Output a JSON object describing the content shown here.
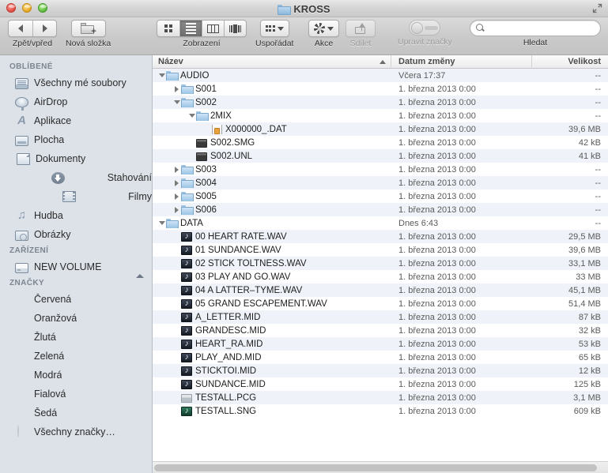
{
  "window": {
    "title": "KROSS",
    "folder_icon": "folder-icon",
    "fullscreen_icon": "fullscreen-icon",
    "traffic_lights": [
      "close-button",
      "minimize-button",
      "zoom-button"
    ]
  },
  "toolbar": {
    "back_forward_label": "Zpět/vpřed",
    "back_icon": "back-arrow-icon",
    "forward_icon": "forward-arrow-icon",
    "new_folder_label": "Nová složka",
    "new_folder_icon": "new-folder-icon",
    "view_label": "Zobrazení",
    "view_modes": [
      {
        "name": "icon-view",
        "icon": "grid-icon",
        "active": false
      },
      {
        "name": "list-view",
        "icon": "list-icon",
        "active": true
      },
      {
        "name": "column-view",
        "icon": "columns-icon",
        "active": false
      },
      {
        "name": "coverflow-view",
        "icon": "coverflow-icon",
        "active": false
      }
    ],
    "arrange_label": "Uspořádat",
    "arrange_icon": "arrange-grid-icon",
    "action_label": "Akce",
    "action_icon": "gear-icon",
    "share_label": "Sdílet",
    "share_icon": "share-icon",
    "share_disabled": true,
    "tags_label": "Upravit značky",
    "tags_icon": "tag-toggle-icon",
    "tags_disabled": true,
    "search_label": "Hledat",
    "search_icon": "search-icon",
    "search_value": "",
    "search_placeholder": ""
  },
  "sidebar": {
    "sections": [
      {
        "header": "OBLÍBENÉ",
        "items": [
          {
            "label": "Všechny mé soubory",
            "icon": "all-files-icon",
            "icon_class": "ico-allfiles"
          },
          {
            "label": "AirDrop",
            "icon": "airdrop-icon",
            "icon_class": "ico-airdrop"
          },
          {
            "label": "Aplikace",
            "icon": "applications-icon",
            "icon_class": "ico-apps",
            "glyph": "A"
          },
          {
            "label": "Plocha",
            "icon": "desktop-icon",
            "icon_class": "ico-desktop"
          },
          {
            "label": "Dokumenty",
            "icon": "documents-icon",
            "icon_class": "ico-docs"
          },
          {
            "label": "Stahování",
            "icon": "downloads-icon",
            "icon_class": "ico-down"
          },
          {
            "label": "Filmy",
            "icon": "movies-icon",
            "icon_class": "ico-movies"
          },
          {
            "label": "Hudba",
            "icon": "music-icon",
            "icon_class": "ico-music",
            "glyph": "♫"
          },
          {
            "label": "Obrázky",
            "icon": "pictures-icon",
            "icon_class": "ico-pics"
          }
        ]
      },
      {
        "header": "ZAŘÍZENÍ",
        "items": [
          {
            "label": "NEW VOLUME",
            "icon": "drive-icon",
            "icon_class": "ico-drive",
            "eject": true,
            "eject_icon": "eject-icon"
          }
        ]
      },
      {
        "header": "ZNAČKY",
        "items": [
          {
            "label": "Červená",
            "icon": "tag-red-icon",
            "dot": "red",
            "color": "#f05a4f"
          },
          {
            "label": "Oranžová",
            "icon": "tag-orange-icon",
            "dot": "orange",
            "color": "#f5a33a"
          },
          {
            "label": "Žlutá",
            "icon": "tag-yellow-icon",
            "dot": "yellow",
            "color": "#f4dc4a"
          },
          {
            "label": "Zelená",
            "icon": "tag-green-icon",
            "dot": "green",
            "color": "#8dc63f"
          },
          {
            "label": "Modrá",
            "icon": "tag-blue-icon",
            "dot": "blue",
            "color": "#5bbdea"
          },
          {
            "label": "Fialová",
            "icon": "tag-purple-icon",
            "dot": "purple",
            "color": "#e078e9"
          },
          {
            "label": "Šedá",
            "icon": "tag-gray-icon",
            "dot": "gray",
            "color": "#c0c0c0"
          },
          {
            "label": "Všechny značky…",
            "icon": "all-tags-icon",
            "dot": "all",
            "color": "#dfe4ea"
          }
        ]
      }
    ]
  },
  "filelist": {
    "columns": [
      {
        "key": "name",
        "label": "Název",
        "sorted": true,
        "sort_icon": "sort-ascending-icon"
      },
      {
        "key": "date",
        "label": "Datum změny",
        "sorted": false
      },
      {
        "key": "size",
        "label": "Velikost",
        "sorted": false
      }
    ],
    "rows": [
      {
        "name": "AUDIO",
        "date": "Včera 17:37",
        "size": "--",
        "indent": 0,
        "disclosure": "open",
        "icon": "folder-icon",
        "icon_class": "folder"
      },
      {
        "name": "S001",
        "date": "1. března 2013 0:00",
        "size": "--",
        "indent": 1,
        "disclosure": "closed",
        "icon": "folder-icon",
        "icon_class": "folder"
      },
      {
        "name": "S002",
        "date": "1. března 2013 0:00",
        "size": "--",
        "indent": 1,
        "disclosure": "open",
        "icon": "folder-icon",
        "icon_class": "folder"
      },
      {
        "name": "2MIX",
        "date": "1. března 2013 0:00",
        "size": "--",
        "indent": 2,
        "disclosure": "open",
        "icon": "folder-icon",
        "icon_class": "folder"
      },
      {
        "name": "X000000_.DAT",
        "date": "1. března 2013 0:00",
        "size": "39,6 MB",
        "indent": 3,
        "disclosure": "none",
        "icon": "locked-document-icon",
        "icon_class": "dat"
      },
      {
        "name": "S002.SMG",
        "date": "1. března 2013 0:00",
        "size": "42 kB",
        "indent": 2,
        "disclosure": "none",
        "icon": "unix-executable-icon",
        "icon_class": "unix"
      },
      {
        "name": "S002.UNL",
        "date": "1. března 2013 0:00",
        "size": "41 kB",
        "indent": 2,
        "disclosure": "none",
        "icon": "unix-executable-icon",
        "icon_class": "unix"
      },
      {
        "name": "S003",
        "date": "1. března 2013 0:00",
        "size": "--",
        "indent": 1,
        "disclosure": "closed",
        "icon": "folder-icon",
        "icon_class": "folder"
      },
      {
        "name": "S004",
        "date": "1. března 2013 0:00",
        "size": "--",
        "indent": 1,
        "disclosure": "closed",
        "icon": "folder-icon",
        "icon_class": "folder"
      },
      {
        "name": "S005",
        "date": "1. března 2013 0:00",
        "size": "--",
        "indent": 1,
        "disclosure": "closed",
        "icon": "folder-icon",
        "icon_class": "folder"
      },
      {
        "name": "S006",
        "date": "1. března 2013 0:00",
        "size": "--",
        "indent": 1,
        "disclosure": "closed",
        "icon": "folder-icon",
        "icon_class": "folder"
      },
      {
        "name": "DATA",
        "date": "Dnes 6:43",
        "size": "--",
        "indent": 0,
        "disclosure": "open",
        "icon": "folder-icon",
        "icon_class": "folder"
      },
      {
        "name": "00 HEART RATE.WAV",
        "date": "1. března 2013 0:00",
        "size": "29,5 MB",
        "indent": 1,
        "disclosure": "none",
        "icon": "audio-file-icon",
        "icon_class": "midi"
      },
      {
        "name": "01 SUNDANCE.WAV",
        "date": "1. března 2013 0:00",
        "size": "39,6 MB",
        "indent": 1,
        "disclosure": "none",
        "icon": "audio-file-icon",
        "icon_class": "midi"
      },
      {
        "name": "02 STICK TOLTNESS.WAV",
        "date": "1. března 2013 0:00",
        "size": "33,1 MB",
        "indent": 1,
        "disclosure": "none",
        "icon": "audio-file-icon",
        "icon_class": "midi"
      },
      {
        "name": "03 PLAY AND GO.WAV",
        "date": "1. března 2013 0:00",
        "size": "33 MB",
        "indent": 1,
        "disclosure": "none",
        "icon": "audio-file-icon",
        "icon_class": "midi"
      },
      {
        "name": "04 A LATTER–TYME.WAV",
        "date": "1. března 2013 0:00",
        "size": "45,1 MB",
        "indent": 1,
        "disclosure": "none",
        "icon": "audio-file-icon",
        "icon_class": "midi"
      },
      {
        "name": "05 GRAND ESCAPEMENT.WAV",
        "date": "1. března 2013 0:00",
        "size": "51,4 MB",
        "indent": 1,
        "disclosure": "none",
        "icon": "audio-file-icon",
        "icon_class": "midi"
      },
      {
        "name": "A_LETTER.MID",
        "date": "1. března 2013 0:00",
        "size": "87 kB",
        "indent": 1,
        "disclosure": "none",
        "icon": "audio-file-icon",
        "icon_class": "midi"
      },
      {
        "name": "GRANDESC.MID",
        "date": "1. března 2013 0:00",
        "size": "32 kB",
        "indent": 1,
        "disclosure": "none",
        "icon": "audio-file-icon",
        "icon_class": "midi"
      },
      {
        "name": "HEART_RA.MID",
        "date": "1. března 2013 0:00",
        "size": "53 kB",
        "indent": 1,
        "disclosure": "none",
        "icon": "audio-file-icon",
        "icon_class": "midi"
      },
      {
        "name": "PLAY_AND.MID",
        "date": "1. března 2013 0:00",
        "size": "65 kB",
        "indent": 1,
        "disclosure": "none",
        "icon": "audio-file-icon",
        "icon_class": "midi"
      },
      {
        "name": "STICKTOI.MID",
        "date": "1. března 2013 0:00",
        "size": "12 kB",
        "indent": 1,
        "disclosure": "none",
        "icon": "audio-file-icon",
        "icon_class": "midi"
      },
      {
        "name": "SUNDANCE.MID",
        "date": "1. března 2013 0:00",
        "size": "125 kB",
        "indent": 1,
        "disclosure": "none",
        "icon": "audio-file-icon",
        "icon_class": "midi"
      },
      {
        "name": "TESTALL.PCG",
        "date": "1. března 2013 0:00",
        "size": "3,1 MB",
        "indent": 1,
        "disclosure": "none",
        "icon": "generic-file-icon",
        "icon_class": "pcg"
      },
      {
        "name": "TESTALL.SNG",
        "date": "1. března 2013 0:00",
        "size": "609 kB",
        "indent": 1,
        "disclosure": "none",
        "icon": "song-file-icon",
        "icon_class": "sng"
      }
    ],
    "scrollbar": {
      "name": "horizontal-scrollbar"
    }
  }
}
